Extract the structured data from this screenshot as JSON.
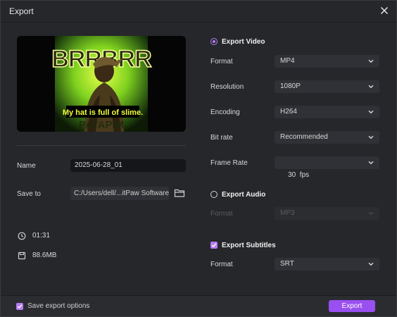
{
  "window": {
    "title": "Export"
  },
  "preview": {
    "caption": "My hat is full of slime.",
    "headline_text": "BRRBRR",
    "bottom_text": "PATAPIM"
  },
  "file": {
    "name_label": "Name",
    "name_value": "2025-06-28_01",
    "save_label": "Save to",
    "save_path": "C:/Users/dell/...itPaw Software",
    "duration": "01:31",
    "size": "88.6MB"
  },
  "export_video": {
    "title": "Export Video",
    "selected": true,
    "rows": [
      {
        "label": "Format",
        "value": "MP4"
      },
      {
        "label": "Resolution",
        "value": "1080P"
      },
      {
        "label": "Encoding",
        "value": "H264"
      },
      {
        "label": "Bit rate",
        "value": "Recommended"
      },
      {
        "label": "Frame Rate",
        "value": "30  fps"
      }
    ]
  },
  "export_audio": {
    "title": "Export Audio",
    "selected": false,
    "format_label": "Format",
    "format_value": "MP3"
  },
  "export_subtitles": {
    "title": "Export Subtitles",
    "checked": true,
    "format_label": "Format",
    "format_value": "SRT"
  },
  "footer": {
    "save_options_label": "Save export options",
    "save_options_checked": true,
    "export_label": "Export"
  },
  "colors": {
    "accent": "#9a4ff0",
    "accent_light": "#b57cf0",
    "background": "#26272b",
    "field": "#303136"
  }
}
